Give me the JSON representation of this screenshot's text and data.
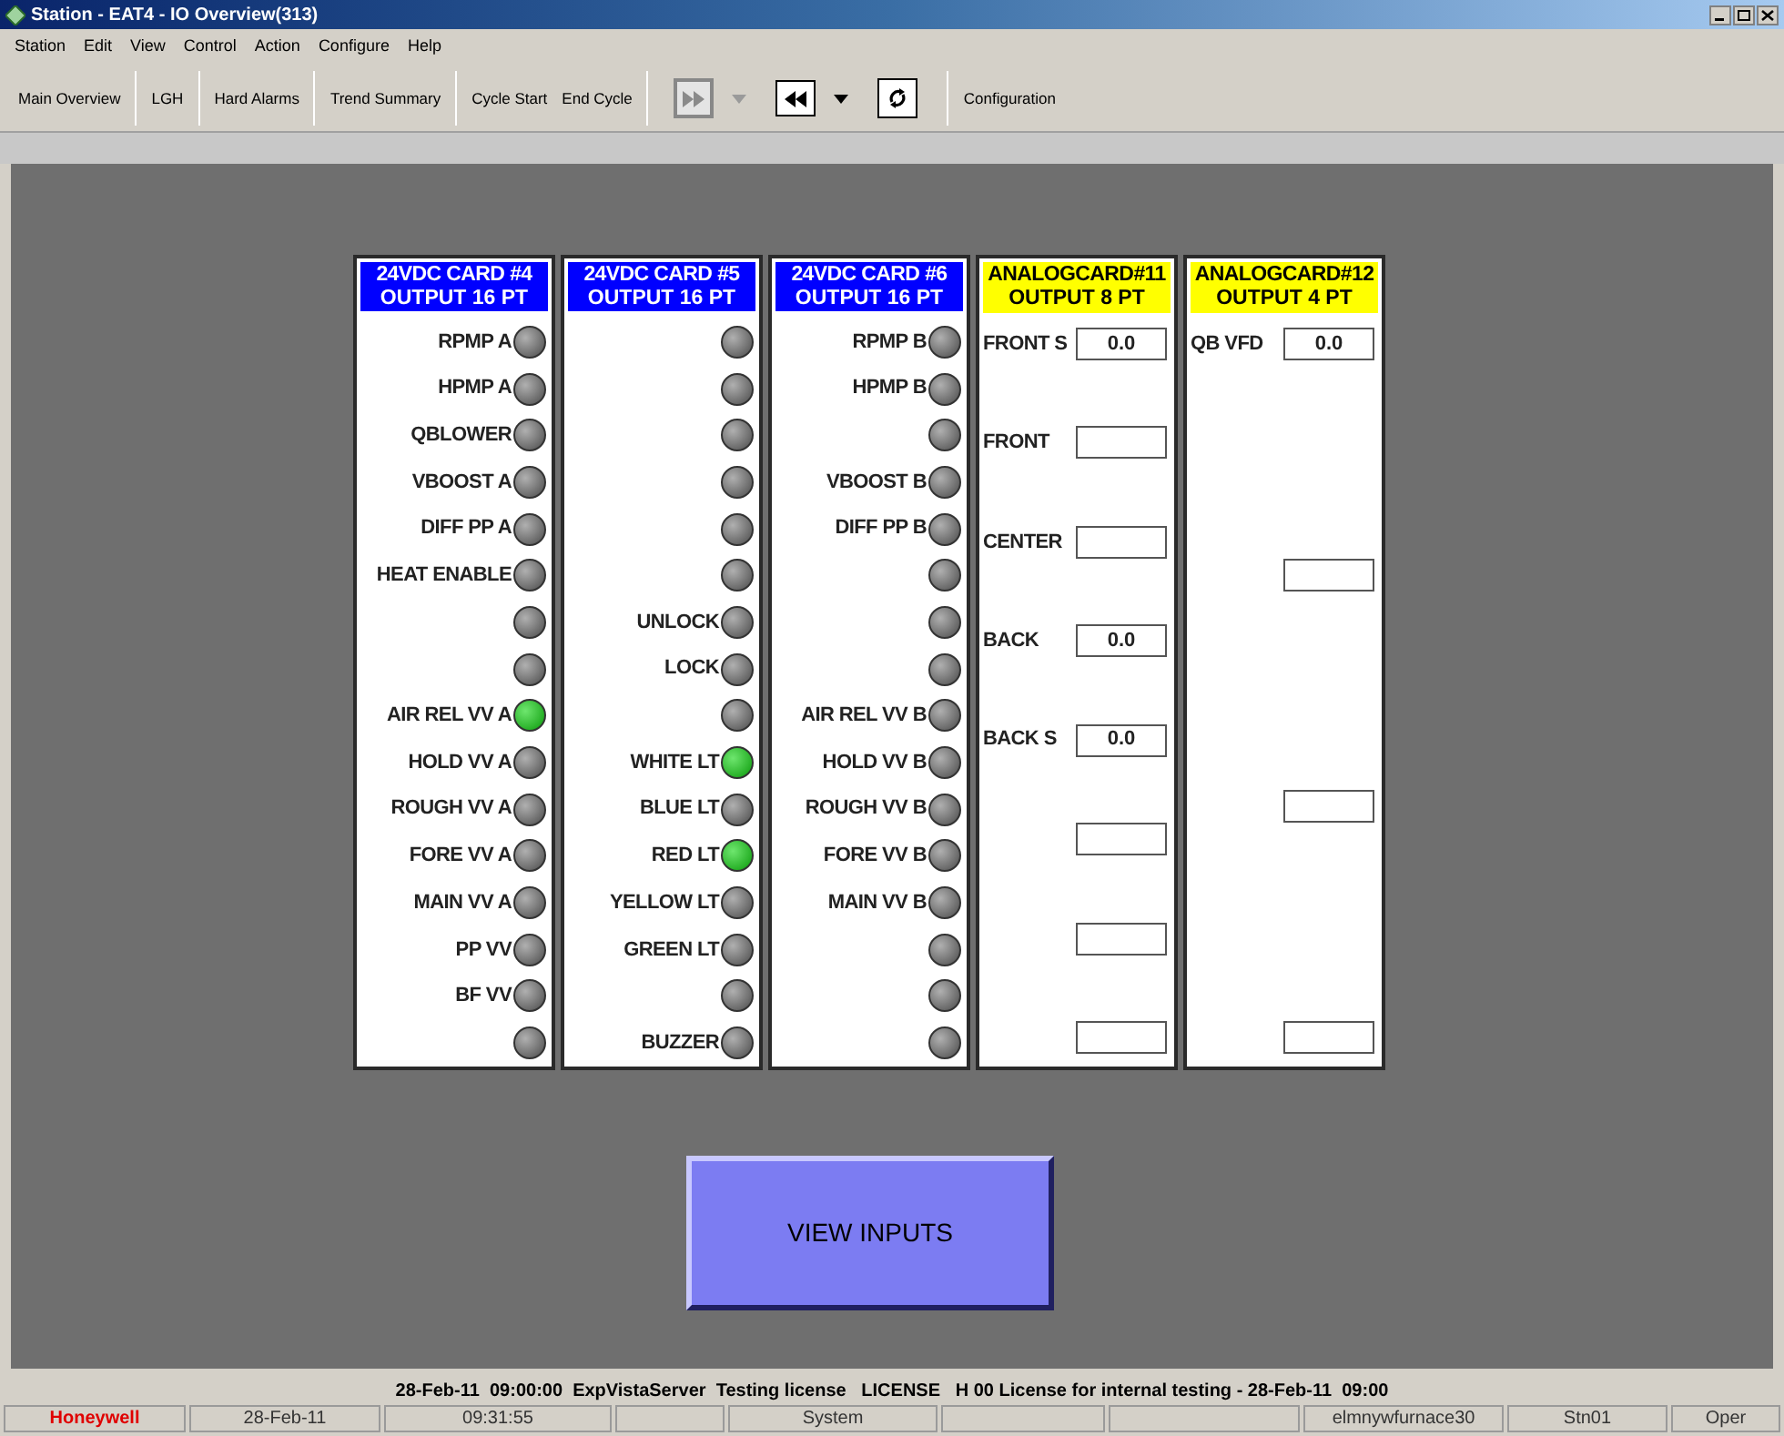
{
  "window": {
    "title": "Station - EAT4 - IO Overview(313)"
  },
  "menu": [
    "Station",
    "Edit",
    "View",
    "Control",
    "Action",
    "Configure",
    "Help"
  ],
  "toolbar": {
    "groups_left": [
      [
        "Main Overview"
      ],
      [
        "LGH"
      ],
      [
        "Hard Alarms"
      ],
      [
        "Trend Summary"
      ],
      [
        "Cycle Start",
        "End Cycle"
      ]
    ],
    "dropdowns": [
      {
        "disabled": true
      },
      {
        "disabled": false
      }
    ],
    "groups_right": [
      [
        "Configuration"
      ]
    ]
  },
  "cards": [
    {
      "kind": "digital",
      "color": "#0000ff",
      "title": "24VDC CARD #4",
      "subtitle": "OUTPUT 16 PT",
      "points": [
        {
          "label": "RPMP A",
          "on": false
        },
        {
          "label": "HPMP A",
          "on": false
        },
        {
          "label": "QBLOWER",
          "on": false
        },
        {
          "label": "VBOOST A",
          "on": false
        },
        {
          "label": "DIFF PP A",
          "on": false
        },
        {
          "label": "HEAT ENABLE",
          "on": false
        },
        {
          "on": false
        },
        {
          "on": false
        },
        {
          "label": "AIR REL VV A",
          "on": true
        },
        {
          "label": "HOLD VV A",
          "on": false
        },
        {
          "label": "ROUGH VV A",
          "on": false
        },
        {
          "label": "FORE VV A",
          "on": false
        },
        {
          "label": "MAIN VV A",
          "on": false
        },
        {
          "label": "PP VV",
          "on": false
        },
        {
          "label": "BF VV",
          "on": false
        },
        {
          "on": false
        }
      ]
    },
    {
      "kind": "digital",
      "color": "#0000ff",
      "title": "24VDC CARD #5",
      "subtitle": "OUTPUT 16 PT",
      "points": [
        {
          "on": false
        },
        {
          "on": false
        },
        {
          "on": false
        },
        {
          "on": false
        },
        {
          "on": false
        },
        {
          "on": false
        },
        {
          "label": "UNLOCK",
          "on": false
        },
        {
          "label": "LOCK",
          "on": false
        },
        {
          "on": false
        },
        {
          "label": "WHITE LT",
          "on": true
        },
        {
          "label": "BLUE LT",
          "on": false
        },
        {
          "label": "RED LT",
          "on": true
        },
        {
          "label": "YELLOW LT",
          "on": false
        },
        {
          "label": "GREEN LT",
          "on": false
        },
        {
          "on": false
        },
        {
          "label": "BUZZER",
          "on": false
        }
      ]
    },
    {
      "kind": "digital",
      "color": "#0000ff",
      "title": "24VDC CARD #6",
      "subtitle": "OUTPUT 16 PT",
      "points": [
        {
          "label": "RPMP B",
          "on": false
        },
        {
          "label": "HPMP B",
          "on": false
        },
        {
          "on": false
        },
        {
          "label": "VBOOST B",
          "on": false
        },
        {
          "label": "DIFF PP B",
          "on": false
        },
        {
          "on": false
        },
        {
          "on": false
        },
        {
          "on": false
        },
        {
          "label": "AIR REL VV B",
          "on": false
        },
        {
          "label": "HOLD VV B",
          "on": false
        },
        {
          "label": "ROUGH VV B",
          "on": false
        },
        {
          "label": "FORE VV B",
          "on": false
        },
        {
          "label": "MAIN VV B",
          "on": false
        },
        {
          "on": false
        },
        {
          "on": false
        },
        {
          "on": false
        }
      ]
    },
    {
      "kind": "analog",
      "color": "#ffff00",
      "title": "ANALOGCARD#11",
      "subtitle": "OUTPUT 8 PT",
      "points": [
        {
          "kind": "labeled",
          "label": "FRONT S",
          "value": "0.0"
        },
        {
          "kind": "labeled",
          "label": "FRONT"
        },
        {
          "kind": "labeled",
          "label": "CENTER"
        },
        {
          "kind": "labeled",
          "label": "BACK",
          "value": "0.0"
        },
        {
          "kind": "labeled",
          "label": "BACK S",
          "value": "0.0"
        },
        {
          "kind": "blank"
        },
        {
          "kind": "blank"
        },
        {
          "kind": "blank"
        }
      ]
    },
    {
      "kind": "analog",
      "color": "#ffff00",
      "title": "ANALOGCARD#12",
      "subtitle": "OUTPUT 4 PT",
      "points": [
        {
          "kind": "labeled",
          "label": "QB VFD",
          "value": "0.0"
        },
        {
          "kind": "blank"
        },
        {
          "kind": "blank"
        },
        {
          "kind": "blank"
        }
      ]
    }
  ],
  "view_inputs_button": "VIEW INPUTS",
  "message": "28-Feb-11  09:00:00  ExpVistaServer  Testing license   LICENSE   H 00 License for internal testing - 28-Feb-11  09:00",
  "status_bar": [
    {
      "kind": "brand",
      "text": "Honeywell"
    },
    {
      "kind": "text",
      "text": "28-Feb-11"
    },
    {
      "kind": "text",
      "text": "09:31:55"
    },
    {
      "kind": "blank"
    },
    {
      "kind": "text",
      "text": "System"
    },
    {
      "kind": "blank"
    },
    {
      "kind": "blank"
    },
    {
      "kind": "text",
      "text": "elmnywfurnace30"
    },
    {
      "kind": "text",
      "text": "Stn01"
    },
    {
      "kind": "text",
      "text": "Oper"
    }
  ]
}
